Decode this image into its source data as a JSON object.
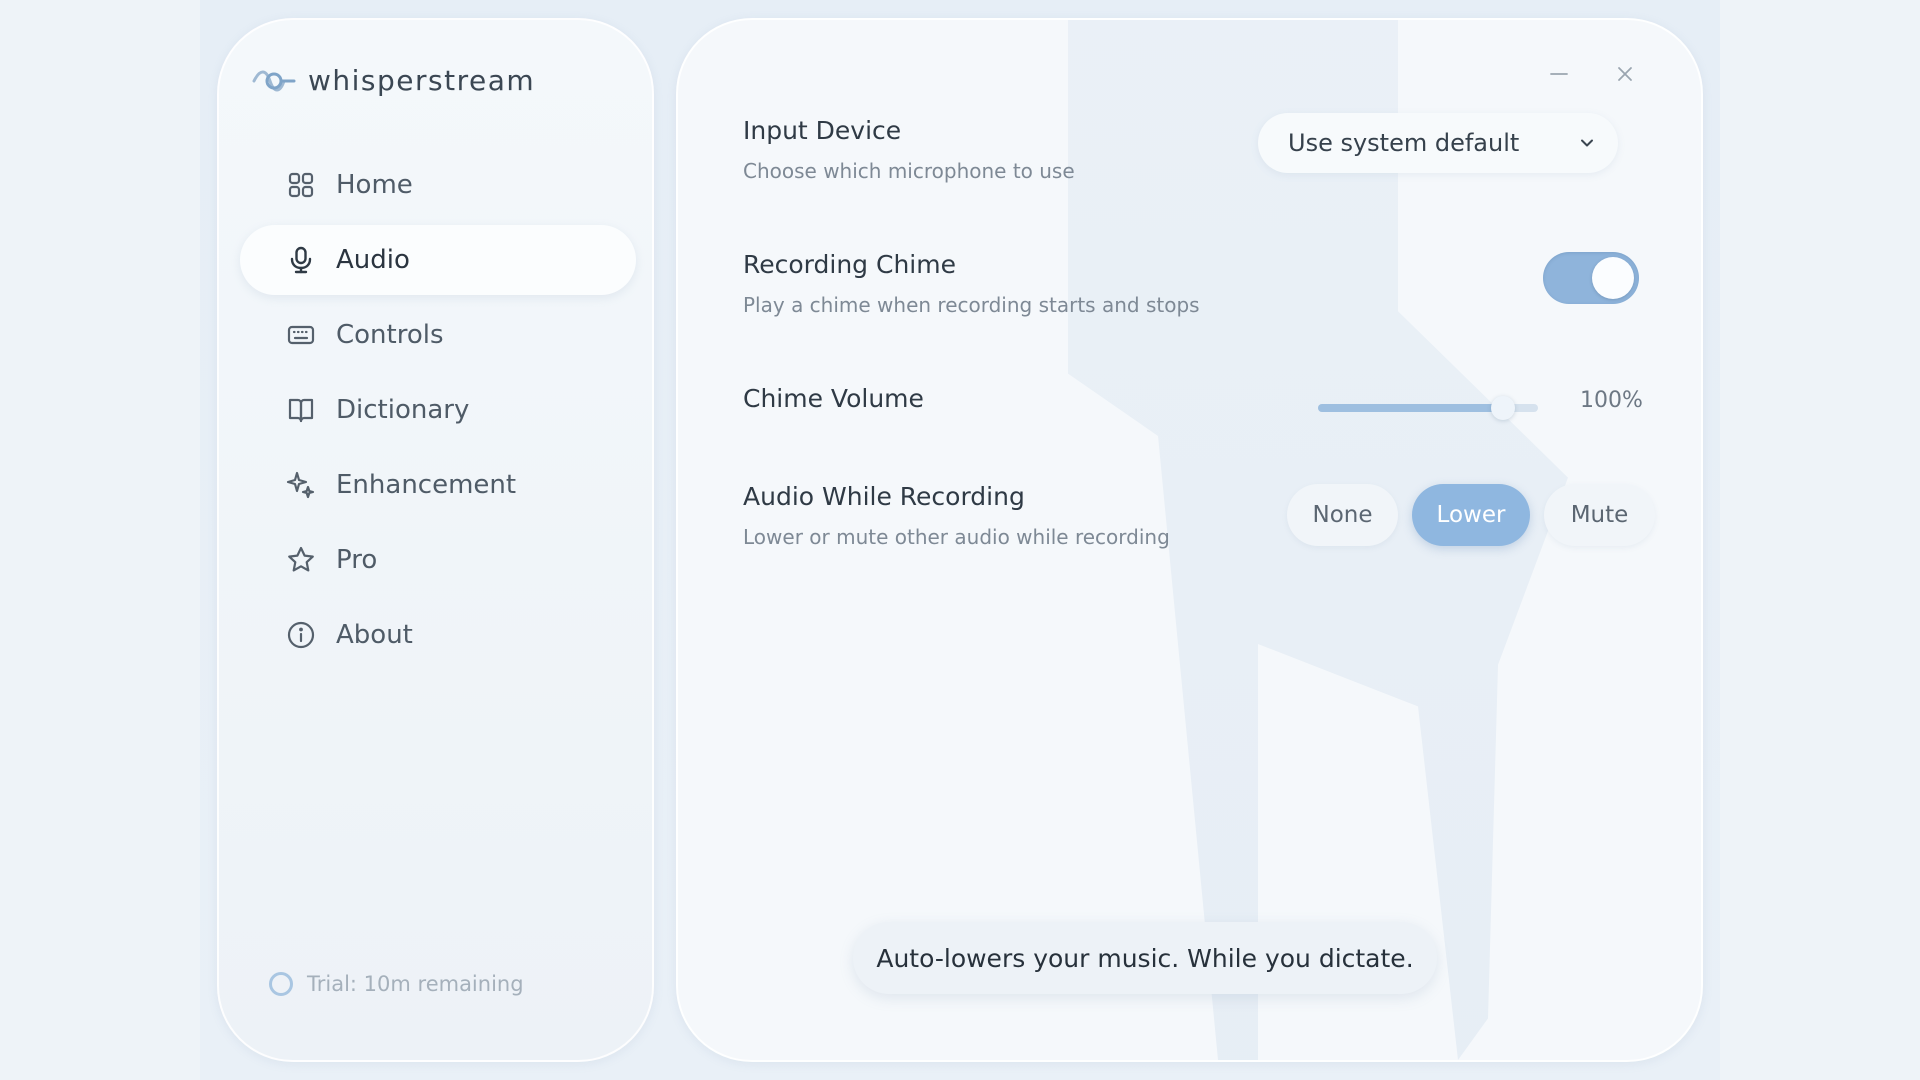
{
  "app": {
    "name": "whisperstream",
    "logo_icon": "waveform-logo-icon"
  },
  "sidebar": {
    "items": [
      {
        "label": "Home",
        "icon": "grid-icon",
        "active": false
      },
      {
        "label": "Audio",
        "icon": "microphone-icon",
        "active": true
      },
      {
        "label": "Controls",
        "icon": "keyboard-icon",
        "active": false
      },
      {
        "label": "Dictionary",
        "icon": "book-icon",
        "active": false
      },
      {
        "label": "Enhancement",
        "icon": "sparkle-icon",
        "active": false
      },
      {
        "label": "Pro",
        "icon": "star-icon",
        "active": false
      },
      {
        "label": "About",
        "icon": "info-icon",
        "active": false
      }
    ],
    "trial_text": "Trial: 10m remaining"
  },
  "window": {
    "minimize_icon": "minimize-icon",
    "close_icon": "close-icon"
  },
  "settings": {
    "input_device": {
      "title": "Input Device",
      "description": "Choose which microphone to use",
      "value": "Use system default"
    },
    "recording_chime": {
      "title": "Recording Chime",
      "description": "Play a chime when recording starts and stops",
      "enabled": true
    },
    "chime_volume": {
      "title": "Chime Volume",
      "value_label": "100%",
      "level": 1.0
    },
    "audio_while_recording": {
      "title": "Audio While Recording",
      "description": "Lower or mute other audio while recording",
      "options": [
        "None",
        "Lower",
        "Mute"
      ],
      "selected": "Lower"
    }
  },
  "banner": {
    "text": "Auto-lowers your music. While you dictate."
  },
  "colors": {
    "accent": "#8fb7e0",
    "background": "#eef3f8",
    "text_primary": "#2f3a45",
    "text_secondary": "#7e8995"
  }
}
